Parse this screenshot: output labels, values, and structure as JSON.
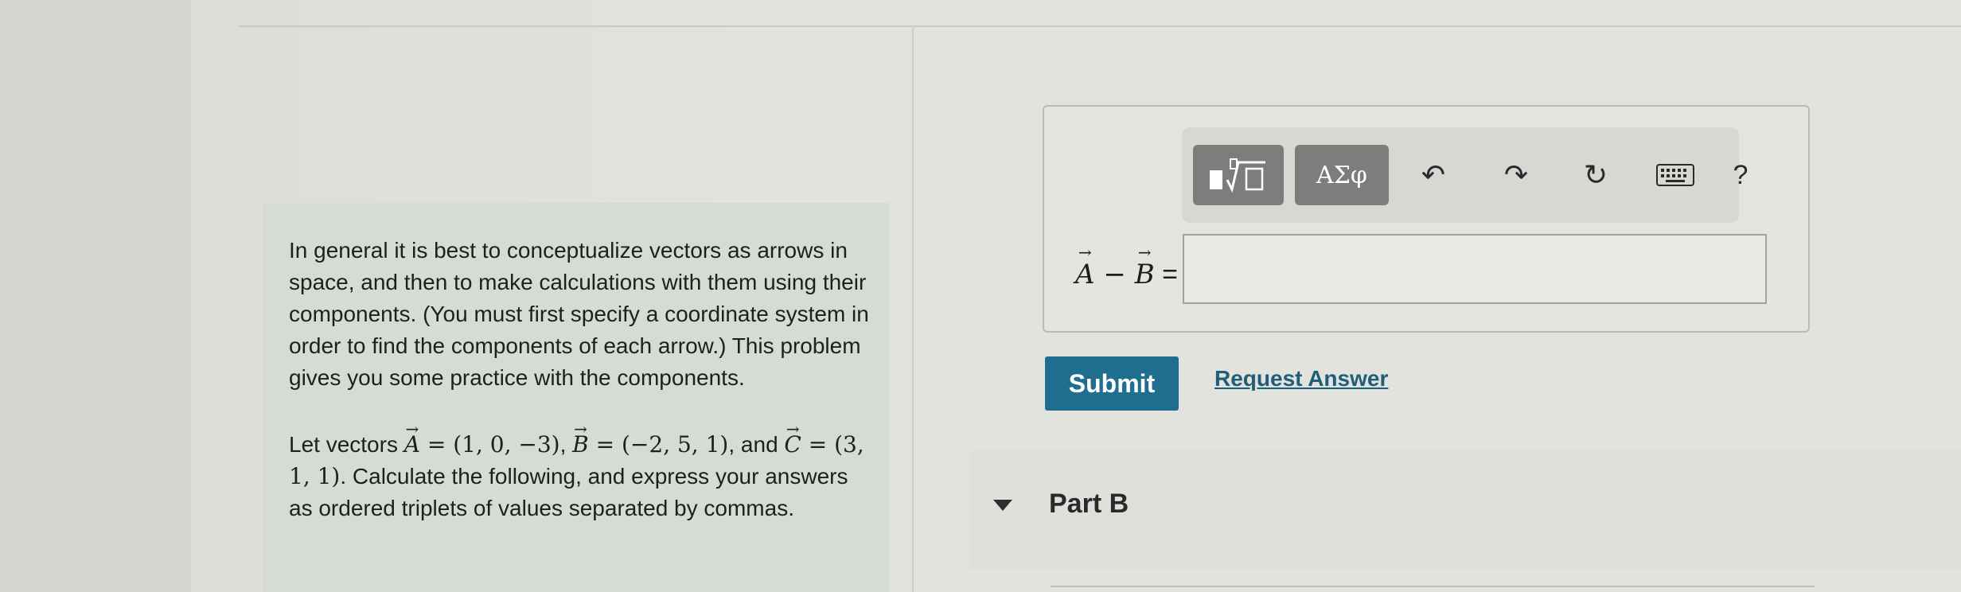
{
  "intro": {
    "paragraph1": "In general it is best to conceptualize vectors as arrows in space, and then to make calculations with them using their components. (You must first specify a coordinate system in order to find the components of each arrow.) This problem gives you some practice with the components.",
    "p2_prefix": "Let vectors ",
    "vecA_letter": "A",
    "vecA_value": " = (1, 0, −3)",
    "p2_comma1": ", ",
    "vecB_letter": "B",
    "vecB_value": " = (−2, 5, 1)",
    "p2_and": ", and ",
    "vecC_letter": "C",
    "vecC_value": " = (3, 1, 1)",
    "p2_suffix": ". Calculate the following, and express your answers as ordered triplets of values separated by commas."
  },
  "toolbar": {
    "templates_icon": "templates-icon",
    "greek_label": "ΑΣφ",
    "undo_glyph": "↶",
    "redo_glyph": "↷",
    "reset_glyph": "↻",
    "help_label": "?"
  },
  "answer": {
    "label_a": "A",
    "label_minus": " − ",
    "label_b": "B",
    "label_eq": " =",
    "input_value": ""
  },
  "actions": {
    "submit_label": "Submit",
    "request_answer_label": "Request Answer"
  },
  "part_b": {
    "title": "Part B"
  },
  "colors": {
    "submit_bg": "#1f6e8f",
    "link": "#1f5e78",
    "intro_panel": "#d5dcd3"
  }
}
